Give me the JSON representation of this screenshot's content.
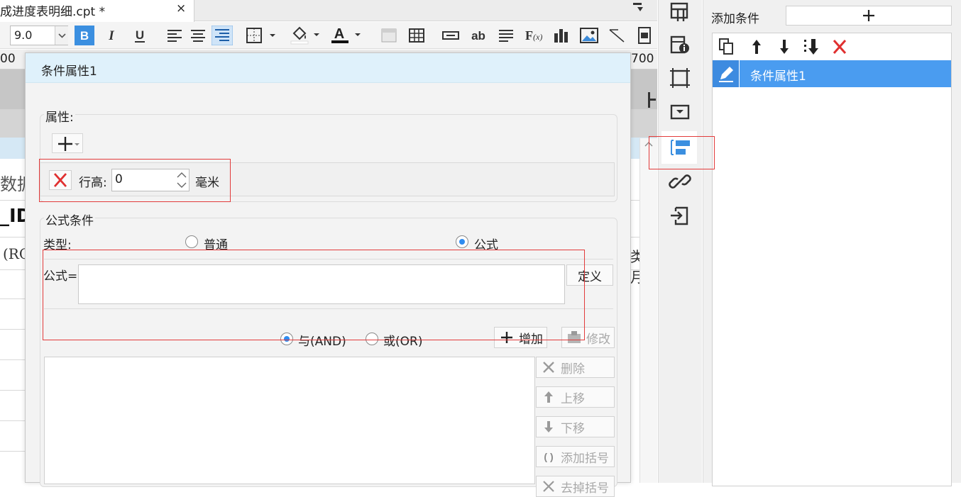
{
  "editor": {
    "tab_title": "成进度表明细.cpt *",
    "tab_close": "×",
    "toolbar": {
      "font_size": "9.0"
    },
    "ruler": {
      "left_mark": "00",
      "right_mark": "700"
    },
    "sheet": {
      "text1": "数据",
      "text2": "_ID",
      "text3": "(RC",
      "text4": "类月"
    }
  },
  "dialog": {
    "title": "条件属性1",
    "attributes": {
      "group_label": "属性:",
      "row_height_label": "行高:",
      "row_height_value": "0",
      "row_height_unit": "毫米"
    },
    "formula_condition": {
      "group_label": "公式条件",
      "type_label": "类型:",
      "type_options": [
        {
          "label": "普通",
          "selected": false
        },
        {
          "label": "公式",
          "selected": true
        }
      ],
      "formula_label": "公式=",
      "formula_value": "",
      "define_button": "定义",
      "logic_options": [
        {
          "label": "与(AND)",
          "selected": true
        },
        {
          "label": "或(OR)",
          "selected": false
        }
      ],
      "buttons": {
        "add": "增加",
        "modify": "修改",
        "delete": "删除",
        "move_up": "上移",
        "move_down": "下移",
        "add_bracket": "添加括号",
        "remove_bracket": "去掉括号"
      }
    }
  },
  "right_panel": {
    "add_condition_label": "添加条件",
    "add_button": "+",
    "conditions": [
      {
        "label": "条件属性1",
        "selected": true
      }
    ]
  },
  "colors": {
    "accent": "#4a9cf0",
    "dialog_title_bg": "#dff1fb",
    "highlight_box": "#e23b3b",
    "delete_red": "#e03030"
  }
}
